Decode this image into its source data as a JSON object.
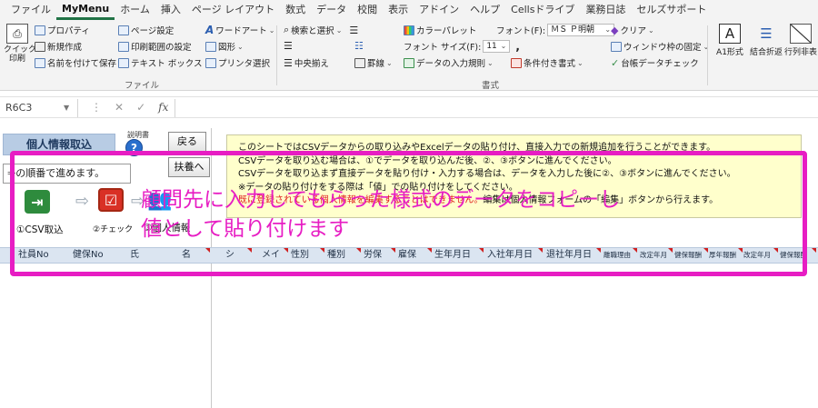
{
  "menu": {
    "items": [
      "ファイル",
      "MyMenu",
      "ホーム",
      "挿入",
      "ページ レイアウト",
      "数式",
      "データ",
      "校閲",
      "表示",
      "アドイン",
      "ヘルプ",
      "Cellsドライブ",
      "業務日誌",
      "セルズサポート"
    ],
    "active": "MyMenu"
  },
  "ribbon": {
    "file_group": {
      "label": "ファイル",
      "quick_print": "クイック\n印刷",
      "property": "プロパティ",
      "new": "新規作成",
      "save_as": "名前を付けて保存",
      "page_setup": "ページ設定",
      "print_area": "印刷範囲の設定",
      "text_box": "テキスト ボックス",
      "wordart": "ワードアート",
      "shapes": "図形",
      "printer_select": "プリンタ選択"
    },
    "format_group": {
      "label": "書式",
      "search_select": "検索と選択",
      "align_center": "中央揃え",
      "border": "罫線",
      "data_validation": "データの入力規則",
      "color_palette": "カラーパレット",
      "font_label": "フォント(F):",
      "font_value": "ＭＳ Ｐ明朝",
      "size_label": "フォント サイズ(F):",
      "size_value": "11",
      "conditional_format": "条件付き書式",
      "clear": "クリア",
      "freeze_panes": "ウィンドウ枠の固定",
      "ledger_check": "台帳データチェック"
    },
    "right_buttons": [
      "A1形式",
      "結合折返",
      "行列非表"
    ]
  },
  "formula_bar": {
    "name_box": "R6C3",
    "fx": "fx",
    "value": ""
  },
  "sheet": {
    "title": "個人情報取込",
    "help_label": "説明書",
    "help_icon": "?",
    "back_button": "戻る",
    "dependents_button": "扶養へ",
    "steps_hint": "⇒の順番で進めます。",
    "steps": [
      {
        "label": "①CSV取込",
        "icon": "import-icon",
        "color": "#2e8b3d"
      },
      {
        "label": "②チェック",
        "icon": "check-icon",
        "color": "#d93025"
      },
      {
        "label": "③個人情報",
        "icon": "people-icon",
        "color": "#222222"
      }
    ],
    "info_lines": [
      "このシートではCSVデータからの取り込みやExcelデータの貼り付け、直接入力での新規追加を行うことができます。",
      "CSVデータを取り込む場合は、①でデータを取り込んだ後、②、③ボタンに進んでください。",
      "CSVデータを取り込まず直接データを貼り付け・入力する場合は、データを入力した後に②、③ボタンに進んでください。",
      "※データの貼り付けをする際は「値」での貼り付けをしてください。"
    ],
    "info_warning_red": "既に登録されている個人情報を編集することはできません。",
    "info_warning_black": "編集は個人情報フォームの「編集」ボタンから行えます。"
  },
  "columns": [
    "社員No",
    "健保No",
    "氏",
    "名",
    "シ",
    "メイ",
    "性別",
    "種別",
    "労保",
    "雇保",
    "生年月日",
    "入社年月日",
    "退社年月日",
    "離職理由",
    "改定年月",
    "健保報酬",
    "厚年報酬",
    "改定年月",
    "健保報酬"
  ],
  "annotation": {
    "line1": "顧問先に入力してもらった様式のデータをコピーし",
    "line2": "値として貼り付けます",
    "color": "#e71dc3"
  }
}
